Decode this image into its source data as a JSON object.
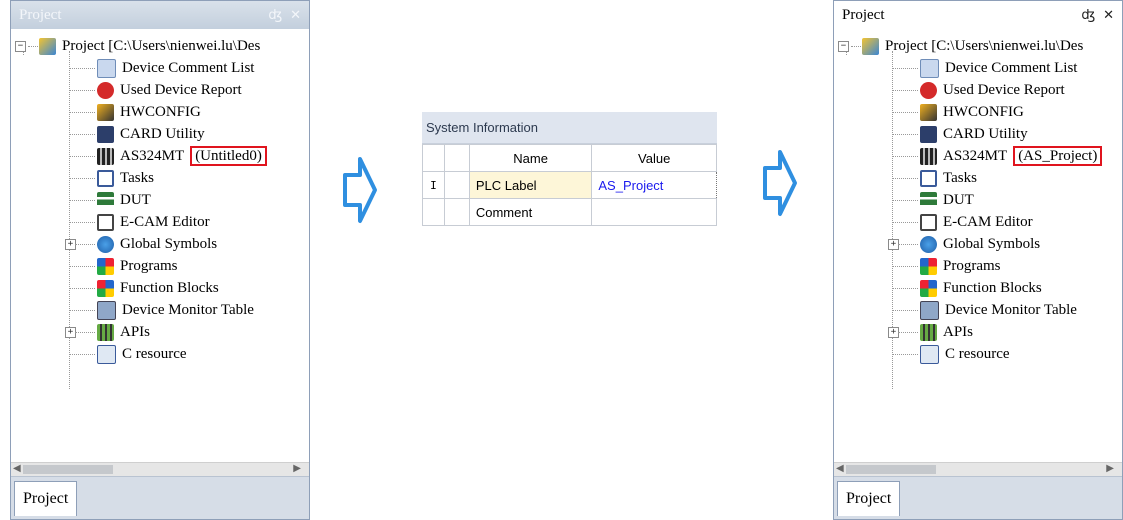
{
  "left_panel": {
    "title": "Project",
    "pin_icon": "pin-icon",
    "close_icon": "close-icon",
    "root_label": "Project [C:\\Users\\nienwei.lu\\Des",
    "items": [
      {
        "label": "Device Comment List",
        "icon": "comment-list-icon"
      },
      {
        "label": "Used Device Report",
        "icon": "device-report-icon"
      },
      {
        "label": "HWCONFIG",
        "icon": "hwconfig-icon"
      },
      {
        "label": "CARD Utility",
        "icon": "card-utility-icon"
      },
      {
        "label": "AS324MT",
        "icon": "plc-icon",
        "tag": "(Untitled0)"
      },
      {
        "label": "Tasks",
        "icon": "tasks-icon"
      },
      {
        "label": "DUT",
        "icon": "dut-icon"
      },
      {
        "label": "E-CAM Editor",
        "icon": "ecam-icon"
      },
      {
        "label": "Global Symbols",
        "icon": "global-symbols-icon"
      },
      {
        "label": "Programs",
        "icon": "programs-icon"
      },
      {
        "label": "Function Blocks",
        "icon": "function-blocks-icon"
      },
      {
        "label": "Device Monitor Table",
        "icon": "monitor-table-icon"
      },
      {
        "label": "APIs",
        "icon": "apis-icon"
      },
      {
        "label": "C resource",
        "icon": "c-resource-icon"
      }
    ],
    "tab_label": "Project"
  },
  "system_information": {
    "title": "System Information",
    "headers": {
      "name": "Name",
      "value": "Value"
    },
    "row_marker": "I",
    "rows": [
      {
        "name": "PLC Label",
        "value": "AS_Project"
      },
      {
        "name": "Comment",
        "value": ""
      }
    ]
  },
  "right_panel": {
    "title": "Project",
    "root_label": "Project [C:\\Users\\nienwei.lu\\Des",
    "items": [
      {
        "label": "Device Comment List"
      },
      {
        "label": "Used Device Report"
      },
      {
        "label": "HWCONFIG"
      },
      {
        "label": "CARD Utility"
      },
      {
        "label": "AS324MT",
        "tag": "(AS_Project)"
      },
      {
        "label": "Tasks"
      },
      {
        "label": "DUT"
      },
      {
        "label": "E-CAM Editor"
      },
      {
        "label": "Global Symbols"
      },
      {
        "label": "Programs"
      },
      {
        "label": "Function Blocks"
      },
      {
        "label": "Device Monitor Table"
      },
      {
        "label": "APIs"
      },
      {
        "label": "C resource"
      }
    ],
    "tab_label": "Project"
  },
  "colors": {
    "highlight": "#e0141e",
    "arrow_fill": "#ffffff",
    "arrow_stroke": "#2f8fe0",
    "value_text": "#1a1aee"
  }
}
